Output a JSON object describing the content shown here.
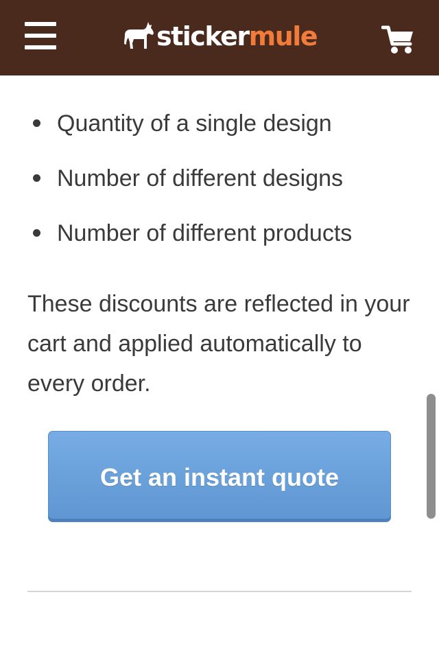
{
  "header": {
    "menu_icon": "hamburger-menu-icon",
    "logo": {
      "part1": "sticker",
      "part2": "mule",
      "mascot_icon": "mule-icon"
    },
    "cart_icon": "shopping-cart-icon",
    "colors": {
      "background": "#4b2a1e",
      "logo_accent": "#f07b3a"
    }
  },
  "content": {
    "bullets": [
      "Quantity of a single design",
      "Number of different designs",
      "Number of different products"
    ],
    "paragraph": "These discounts are reflected in your cart and applied automatically to every order.",
    "cta_label": "Get an instant quote",
    "cta_color": "#6a9fdb"
  }
}
